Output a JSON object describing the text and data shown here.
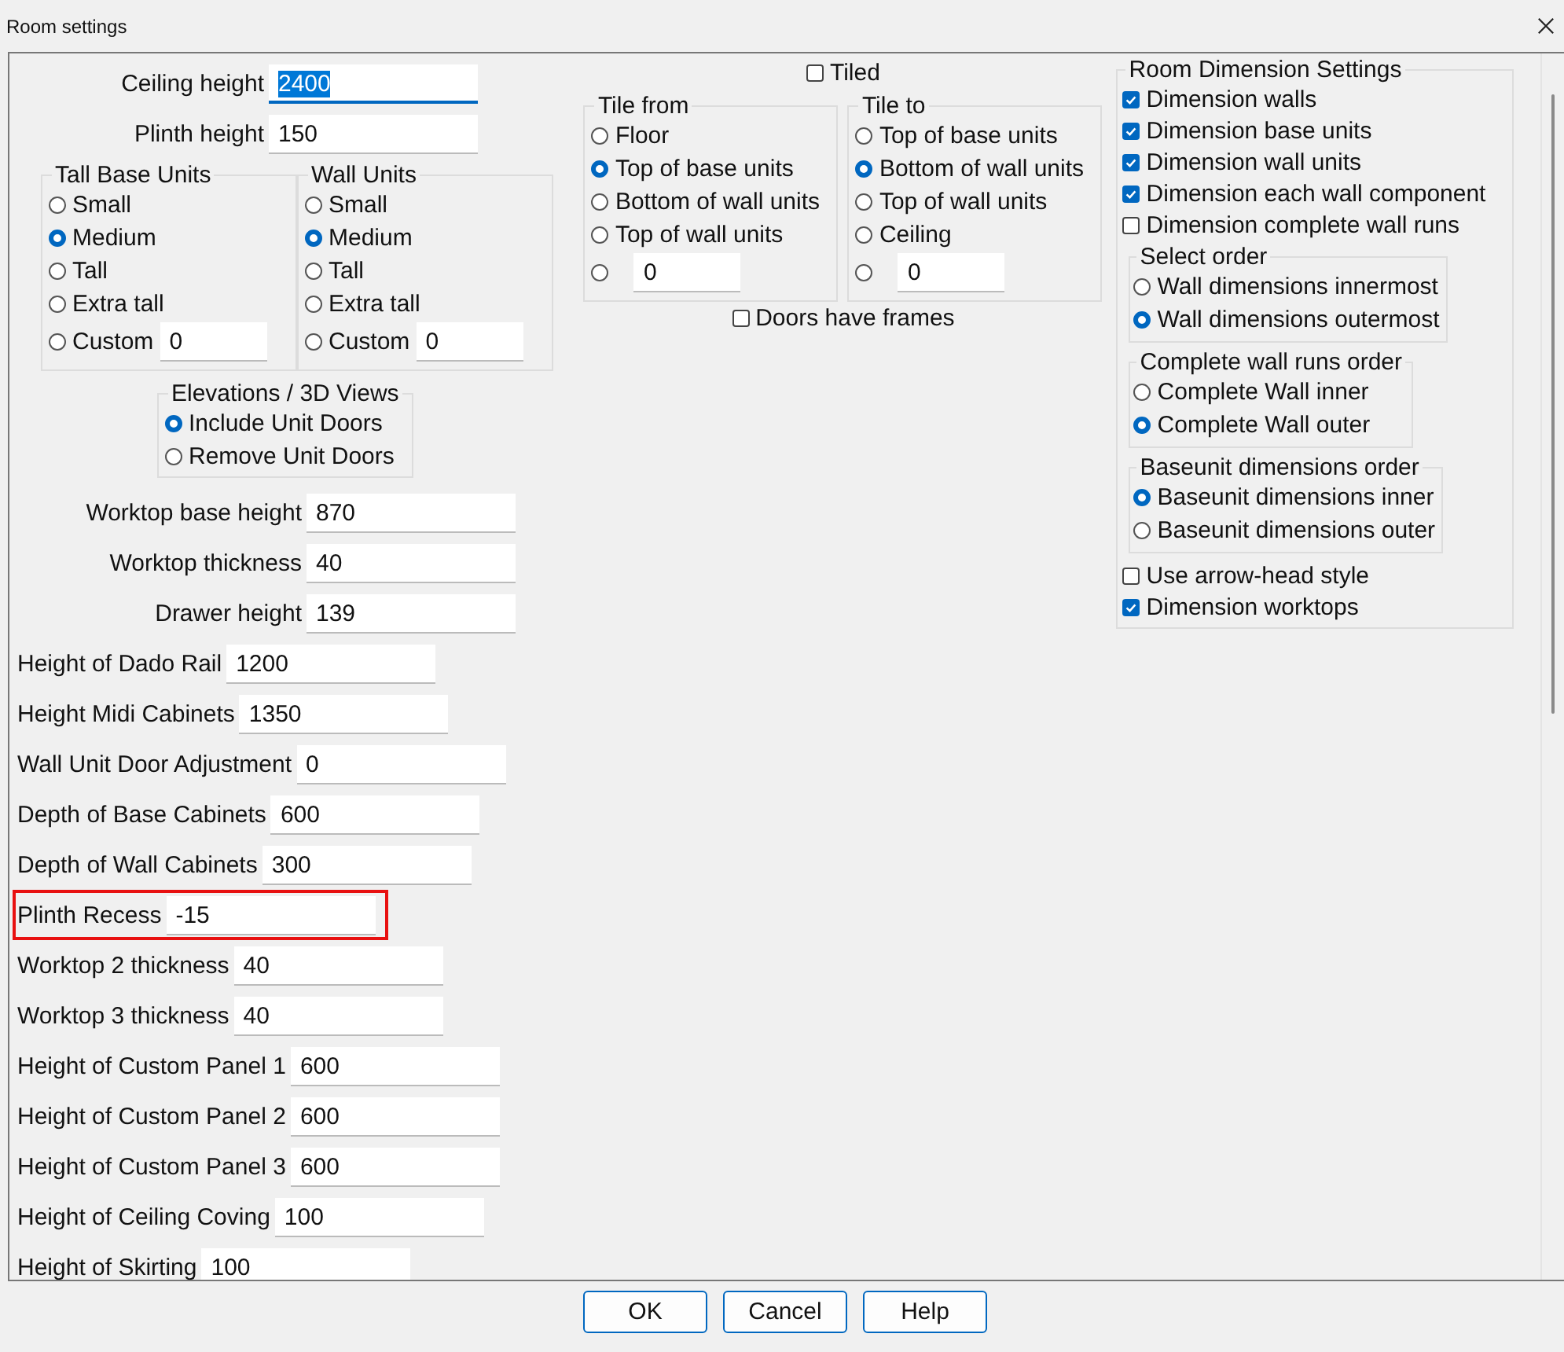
{
  "window": {
    "title": "Room settings"
  },
  "top_fields": [
    {
      "label": "Ceiling height",
      "value": "2400",
      "focused": true
    },
    {
      "label": "Plinth height",
      "value": "150",
      "focused": false
    }
  ],
  "unit_groups": [
    {
      "title": "Tall Base Units",
      "options": [
        {
          "kind": "radio",
          "label": "Small",
          "selected": false
        },
        {
          "kind": "radio",
          "label": "Medium",
          "selected": true
        },
        {
          "kind": "radio",
          "label": "Tall",
          "selected": false
        },
        {
          "kind": "radio",
          "label": "Extra tall",
          "selected": false
        },
        {
          "kind": "input",
          "label": "Custom",
          "value": "0",
          "selected": false
        }
      ]
    },
    {
      "title": "Wall Units",
      "options": [
        {
          "kind": "radio",
          "label": "Small",
          "selected": false
        },
        {
          "kind": "radio",
          "label": "Medium",
          "selected": true
        },
        {
          "kind": "radio",
          "label": "Tall",
          "selected": false
        },
        {
          "kind": "radio",
          "label": "Extra tall",
          "selected": false
        },
        {
          "kind": "input",
          "label": "Custom",
          "value": "0",
          "selected": false
        }
      ]
    }
  ],
  "elevations": {
    "title": "Elevations / 3D Views",
    "options": [
      {
        "kind": "radio",
        "label": "Include Unit Doors",
        "selected": true
      },
      {
        "kind": "radio",
        "label": "Remove Unit Doors",
        "selected": false
      }
    ]
  },
  "mid_fields": [
    {
      "label": "Worktop base height",
      "value": "870"
    },
    {
      "label": "Worktop thickness",
      "value": "40"
    },
    {
      "label": "Drawer height",
      "value": "139"
    }
  ],
  "fields": [
    {
      "label": "Height of Dado Rail",
      "value": "1200",
      "highlighted": false
    },
    {
      "label": "Height Midi Cabinets",
      "value": "1350",
      "highlighted": false
    },
    {
      "label": "Wall Unit Door Adjustment",
      "value": "0",
      "highlighted": false
    },
    {
      "label": "Depth of Base Cabinets",
      "value": "600",
      "highlighted": false
    },
    {
      "label": "Depth of Wall Cabinets",
      "value": "300",
      "highlighted": false
    },
    {
      "label": "Plinth Recess",
      "value": "-15",
      "highlighted": true
    },
    {
      "label": "Worktop 2 thickness",
      "value": "40",
      "highlighted": false
    },
    {
      "label": "Worktop 3 thickness",
      "value": "40",
      "highlighted": false
    },
    {
      "label": "Height of Custom Panel 1",
      "value": "600",
      "highlighted": false
    },
    {
      "label": "Height of Custom Panel 2",
      "value": "600",
      "highlighted": false
    },
    {
      "label": "Height of Custom Panel 3",
      "value": "600",
      "highlighted": false
    },
    {
      "label": "Height of Ceiling Coving",
      "value": "100",
      "highlighted": false
    },
    {
      "label": "Height of Skirting",
      "value": "100",
      "highlighted": false
    }
  ],
  "tiled": {
    "label": "Tiled",
    "checked": false
  },
  "tile_groups": [
    {
      "title": "Tile from",
      "options": [
        {
          "kind": "radio",
          "label": "Floor",
          "selected": false
        },
        {
          "kind": "radio",
          "label": "Top of base units",
          "selected": true
        },
        {
          "kind": "radio",
          "label": "Bottom of wall units",
          "selected": false
        },
        {
          "kind": "radio",
          "label": "Top of wall units",
          "selected": false
        },
        {
          "kind": "input",
          "value": "0",
          "selected": false
        }
      ]
    },
    {
      "title": "Tile to",
      "options": [
        {
          "kind": "radio",
          "label": "Top of base units",
          "selected": false
        },
        {
          "kind": "radio",
          "label": "Bottom of wall units",
          "selected": true
        },
        {
          "kind": "radio",
          "label": "Top of wall units",
          "selected": false
        },
        {
          "kind": "radio",
          "label": "Ceiling",
          "selected": false
        },
        {
          "kind": "input",
          "value": "0",
          "selected": false
        }
      ]
    }
  ],
  "doors_frames": {
    "label": "Doors have frames",
    "checked": false
  },
  "dimension": {
    "title": "Room Dimension Settings",
    "checks": [
      {
        "label": "Dimension walls",
        "checked": true
      },
      {
        "label": "Dimension base units",
        "checked": true
      },
      {
        "label": "Dimension wall units",
        "checked": true
      },
      {
        "label": "Dimension each wall component",
        "checked": true
      },
      {
        "label": "Dimension complete wall runs",
        "checked": false
      }
    ],
    "orders": [
      {
        "title": "Select order",
        "options": [
          {
            "kind": "radio",
            "label": "Wall dimensions innermost",
            "selected": false
          },
          {
            "kind": "radio",
            "label": "Wall dimensions outermost",
            "selected": true
          }
        ]
      },
      {
        "title": "Complete wall runs order",
        "options": [
          {
            "kind": "radio",
            "label": "Complete Wall inner",
            "selected": false
          },
          {
            "kind": "radio",
            "label": "Complete Wall outer",
            "selected": true
          }
        ]
      },
      {
        "title": "Baseunit dimensions order",
        "options": [
          {
            "kind": "radio",
            "label": "Baseunit dimensions inner",
            "selected": true
          },
          {
            "kind": "radio",
            "label": "Baseunit dimensions outer",
            "selected": false
          }
        ]
      }
    ],
    "checks_after": [
      {
        "label": "Use arrow-head style",
        "checked": false
      },
      {
        "label": "Dimension worktops",
        "checked": true
      }
    ]
  },
  "buttons": [
    {
      "label": "OK"
    },
    {
      "label": "Cancel"
    },
    {
      "label": "Help"
    }
  ]
}
